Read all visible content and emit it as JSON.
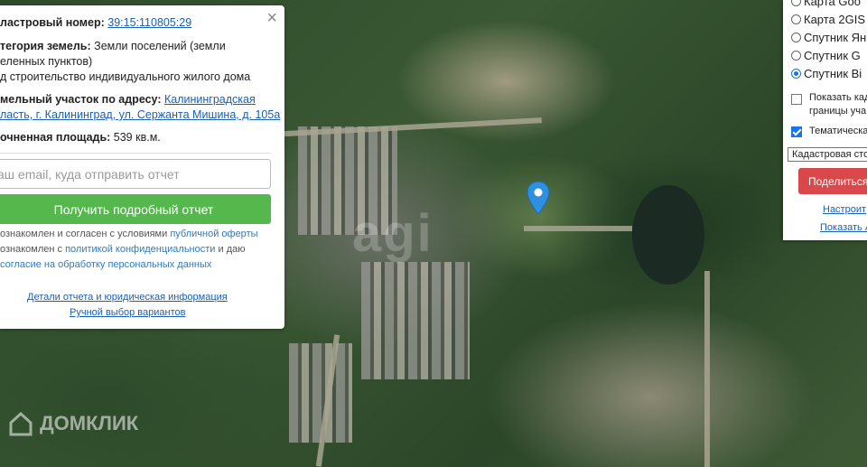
{
  "info": {
    "cadastral_label": "ластровый номер:",
    "cadastral_number": "39:15:110805:29",
    "category_label": "тегория земель:",
    "category_value": "Земли поселений (земли",
    "category_line2": "еленных пунктов)",
    "category_line3": "д строительство индивидуального жилого дома",
    "address_label": "мельный участок по адресу:",
    "address_link_1": "Калининградская",
    "address_link_2": "ласть, г. Калининград, ул. Сержанта Мишина, д. 105а",
    "area_label": "очненная площадь:",
    "area_value": "539 кв.м.",
    "email_placeholder": "аш email, куда отправить отчет",
    "cta_label": "Получить подробный отчет",
    "legal_1_text": "ознакомлен и согласен с условиями",
    "legal_1_link": "публичной оферты",
    "legal_2_text": "ознакомлен с",
    "legal_2_link": "политикой конфиденциальности",
    "legal_2_tail": "и даю",
    "legal_3_link": "согласие на обработку персональных данных",
    "details_link": "Детали отчета и юридическая информация",
    "manual_link": "Ручной выбор вариантов",
    "close_glyph": "×"
  },
  "layers": {
    "options": [
      {
        "label": "Карта Goo",
        "selected": false
      },
      {
        "label": "Карта 2GIS",
        "selected": false
      },
      {
        "label": "Спутник Ян",
        "selected": false
      },
      {
        "label": "Спутник G",
        "selected": false
      },
      {
        "label": "Спутник Bi",
        "selected": true
      }
    ],
    "check_borders_line1": "Показать кад",
    "check_borders_line2": "границы уча",
    "check_borders": false,
    "check_thematic": "Тематическа",
    "check_thematic_on": true,
    "select_value": "Кадастровая сто",
    "share_label": "Поделиться",
    "configure_link": "Настроит",
    "show_link": "Показать А"
  },
  "map": {
    "watermark": "agi",
    "brand": "ДОМКЛИК"
  },
  "colors": {
    "accent_green": "#54b84c",
    "share_red": "#d9484a",
    "pin_blue": "#2f8fe0"
  }
}
